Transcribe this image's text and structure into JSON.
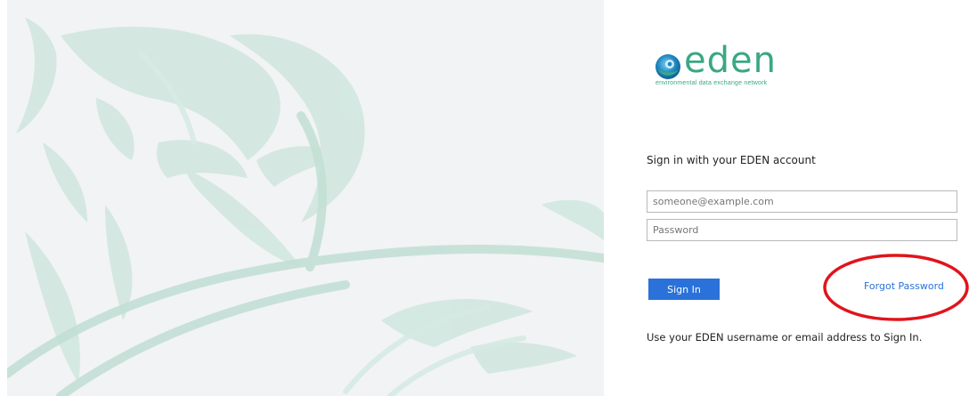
{
  "brand": {
    "name": "eden",
    "tagline": "environmental data exchange network",
    "color": "#3aa883"
  },
  "signin": {
    "heading": "Sign in with your EDEN account",
    "email_placeholder": "someone@example.com",
    "password_placeholder": "Password",
    "signin_label": "Sign In",
    "forgot_label": "Forgot Password",
    "hint": "Use your EDEN username or email address to Sign In."
  },
  "colors": {
    "accent": "#2a72d9",
    "annotation": "#e0141c",
    "illustration_bg": "#f1f3f4",
    "illustration_strokes": "#cfe7df"
  }
}
